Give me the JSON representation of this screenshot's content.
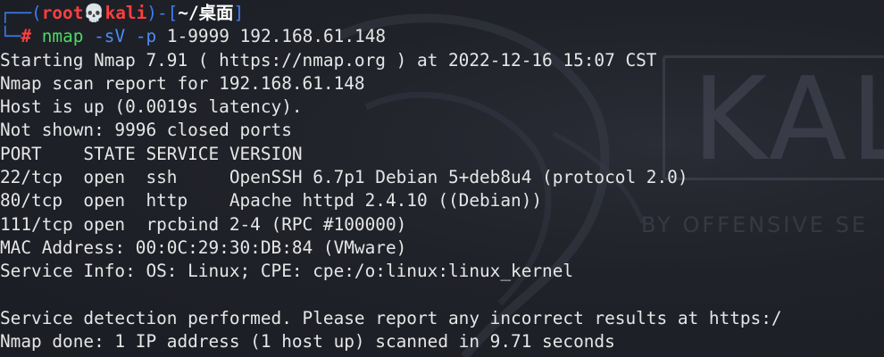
{
  "prompt": {
    "corner_top": "┌──(",
    "user": "root",
    "skull": "💀",
    "host": "kali",
    "close_paren": ")-[",
    "path": "~/桌面",
    "close_bracket": "]",
    "corner_bottom": "└─",
    "hash": "#",
    "command": "nmap",
    "flag_sv": "-sV",
    "flag_p": "-p",
    "args": "1-9999 192.168.61.148"
  },
  "output_lines": [
    "Starting Nmap 7.91 ( https://nmap.org ) at 2022-12-16 15:07 CST",
    "Nmap scan report for 192.168.61.148",
    "Host is up (0.0019s latency).",
    "Not shown: 9996 closed ports",
    "PORT    STATE SERVICE VERSION",
    "22/tcp  open  ssh     OpenSSH 6.7p1 Debian 5+deb8u4 (protocol 2.0)",
    "80/tcp  open  http    Apache httpd 2.4.10 ((Debian))",
    "111/tcp open  rpcbind 2-4 (RPC #100000)",
    "MAC Address: 00:0C:29:30:DB:84 (VMware)",
    "Service Info: OS: Linux; CPE: cpe:/o:linux:linux_kernel",
    "",
    "Service detection performed. Please report any incorrect results at https:/",
    "Nmap done: 1 IP address (1 host up) scanned in 9.71 seconds"
  ],
  "watermark": {
    "logo_text": "KAL",
    "tagline": "BY OFFENSIVE SE"
  },
  "colors": {
    "background": "#1d1f28",
    "prompt_frame": "#3b7df0",
    "user_host": "#ff3f3f",
    "command": "#4cd964",
    "flags": "#4b8bf5",
    "text": "#e6e6e6"
  }
}
